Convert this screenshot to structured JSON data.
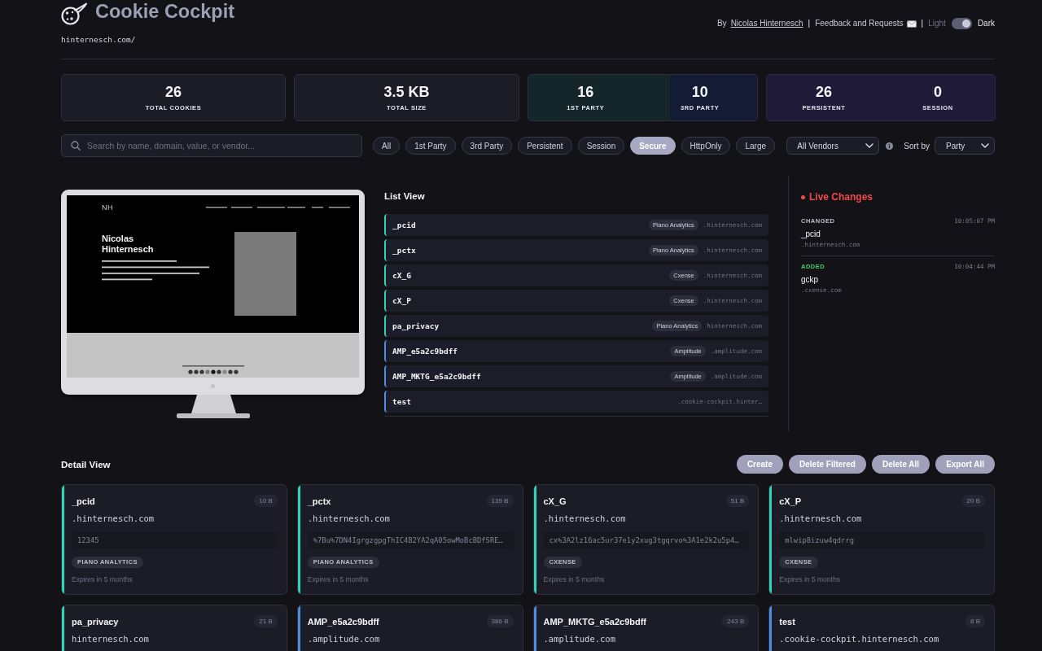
{
  "header": {
    "title": "Cookie Cockpit",
    "url": "hinternesch.com/",
    "byline": "By",
    "author": "Nicolas Hinternesch",
    "feedback": "Feedback and Requests",
    "separators": [
      "|",
      "|"
    ],
    "theme_light": "Light",
    "theme_dark": "Dark",
    "dark_mode": true
  },
  "stats": [
    {
      "items": [
        {
          "value": "26",
          "label": "TOTAL COOKIES"
        }
      ]
    },
    {
      "items": [
        {
          "value": "3.5 KB",
          "label": "TOTAL SIZE"
        }
      ]
    },
    {
      "level": 0.62,
      "items": [
        {
          "value": "16",
          "label": "1ST PARTY",
          "color": "#15262b"
        },
        {
          "value": "10",
          "label": "3RD PARTY",
          "color": "#131c34"
        }
      ]
    },
    {
      "color": "#1f1a38",
      "items": [
        {
          "value": "26",
          "label": "PERSISTENT"
        },
        {
          "value": "0",
          "label": "SESSION"
        }
      ]
    }
  ],
  "filters": {
    "search": {
      "placeholder": "Search by name, domain, value, or vendor..."
    },
    "chips": [
      {
        "label": "All",
        "selected": false
      },
      {
        "label": "1st Party",
        "selected": false
      },
      {
        "label": "3rd Party",
        "selected": false
      },
      {
        "label": "Persistent",
        "selected": false
      },
      {
        "label": "Session",
        "selected": false
      },
      {
        "label": "Secure",
        "selected": true
      },
      {
        "label": "HttpOnly",
        "selected": false
      },
      {
        "label": "Large",
        "selected": false
      }
    ],
    "vendor": {
      "value": "All Vendors"
    },
    "sort": {
      "label": "Sort by",
      "value": "Party"
    }
  },
  "preview": {
    "logo": "NH",
    "heading": "Nicolas Hinternesch"
  },
  "list_view": {
    "title": "List View",
    "items": [
      {
        "name": "_pcid",
        "vendor": "Piano Analytics",
        "domain": ".hinternesch.com",
        "color": "#2fd3b5"
      },
      {
        "name": "_pctx",
        "vendor": "Piano Analytics",
        "domain": ".hinternesch.com",
        "color": "#2fd3b5"
      },
      {
        "name": "cX_G",
        "vendor": "Cxense",
        "domain": ".hinternesch.com",
        "color": "#2fd3b5"
      },
      {
        "name": "cX_P",
        "vendor": "Cxense",
        "domain": ".hinternesch.com",
        "color": "#2fd3b5"
      },
      {
        "name": "pa_privacy",
        "vendor": "Piano Analytics",
        "domain": "hinternesch.com",
        "color": "#2fd3b5"
      },
      {
        "name": "AMP_e5a2c9bdff",
        "vendor": "Amplitude",
        "domain": ".amplitude.com",
        "color": "#4a8fe0"
      },
      {
        "name": "AMP_MKTG_e5a2c9bdff",
        "vendor": "Amplitude",
        "domain": ".amplitude.com",
        "color": "#4a8fe0"
      },
      {
        "name": "test",
        "domain": ".cookie-cockpit.hinter…",
        "color": "#4a8fe0"
      }
    ]
  },
  "live_changes": {
    "title": "Live Changes",
    "entries": [
      {
        "kind": "changed",
        "label": "CHANGED",
        "time": "10:05:07 PM",
        "name": "_pcid",
        "domain": ".hinternesch.com"
      },
      {
        "kind": "added",
        "label": "ADDED",
        "time": "10:04:44 PM",
        "name": "gckp",
        "domain": ".cxense.com"
      }
    ]
  },
  "detail_view": {
    "title": "Detail View",
    "buttons": [
      "Create",
      "Delete Filtered",
      "Delete All",
      "Export All"
    ],
    "cards": [
      {
        "name": "_pcid",
        "size": "10 B",
        "domain": ".hinternesch.com",
        "value": "12345",
        "vendor": "PIANO ANALYTICS",
        "expires": "Expires in 5 months",
        "color": "#2fd3b5"
      },
      {
        "name": "_pctx",
        "size": "139 B",
        "domain": ".hinternesch.com",
        "value": "%7Bu%7DN4IgrgzgpgThIC4B2YA2qA05owMoBcBDfSRE…",
        "vendor": "PIANO ANALYTICS",
        "expires": "Expires in 5 months",
        "color": "#2fd3b5"
      },
      {
        "name": "cX_G",
        "size": "51 B",
        "domain": ".hinternesch.com",
        "value": "cx%3A2lz16ac5ur37e1y2xug3tgqrvo%3A1e2k2u5p4…",
        "vendor": "CXENSE",
        "expires": "Expires in 5 months",
        "color": "#2fd3b5"
      },
      {
        "name": "cX_P",
        "size": "20 B",
        "domain": ".hinternesch.com",
        "value": "mlwip8izuw4qdrrg",
        "vendor": "CXENSE",
        "expires": "Expires in 5 months",
        "color": "#2fd3b5"
      },
      {
        "name": "pa_privacy",
        "size": "21 B",
        "domain": "hinternesch.com",
        "color": "#2fd3b5"
      },
      {
        "name": "AMP_e5a2c9bdff",
        "size": "386 B",
        "domain": ".amplitude.com",
        "color": "#4a8fe0"
      },
      {
        "name": "AMP_MKTG_e5a2c9bdff",
        "size": "243 B",
        "domain": ".amplitude.com",
        "color": "#4a8fe0"
      },
      {
        "name": "test",
        "size": "8 B",
        "domain": ".cookie-cockpit.hinternesch.com",
        "color": "#4a8fe0"
      }
    ]
  }
}
